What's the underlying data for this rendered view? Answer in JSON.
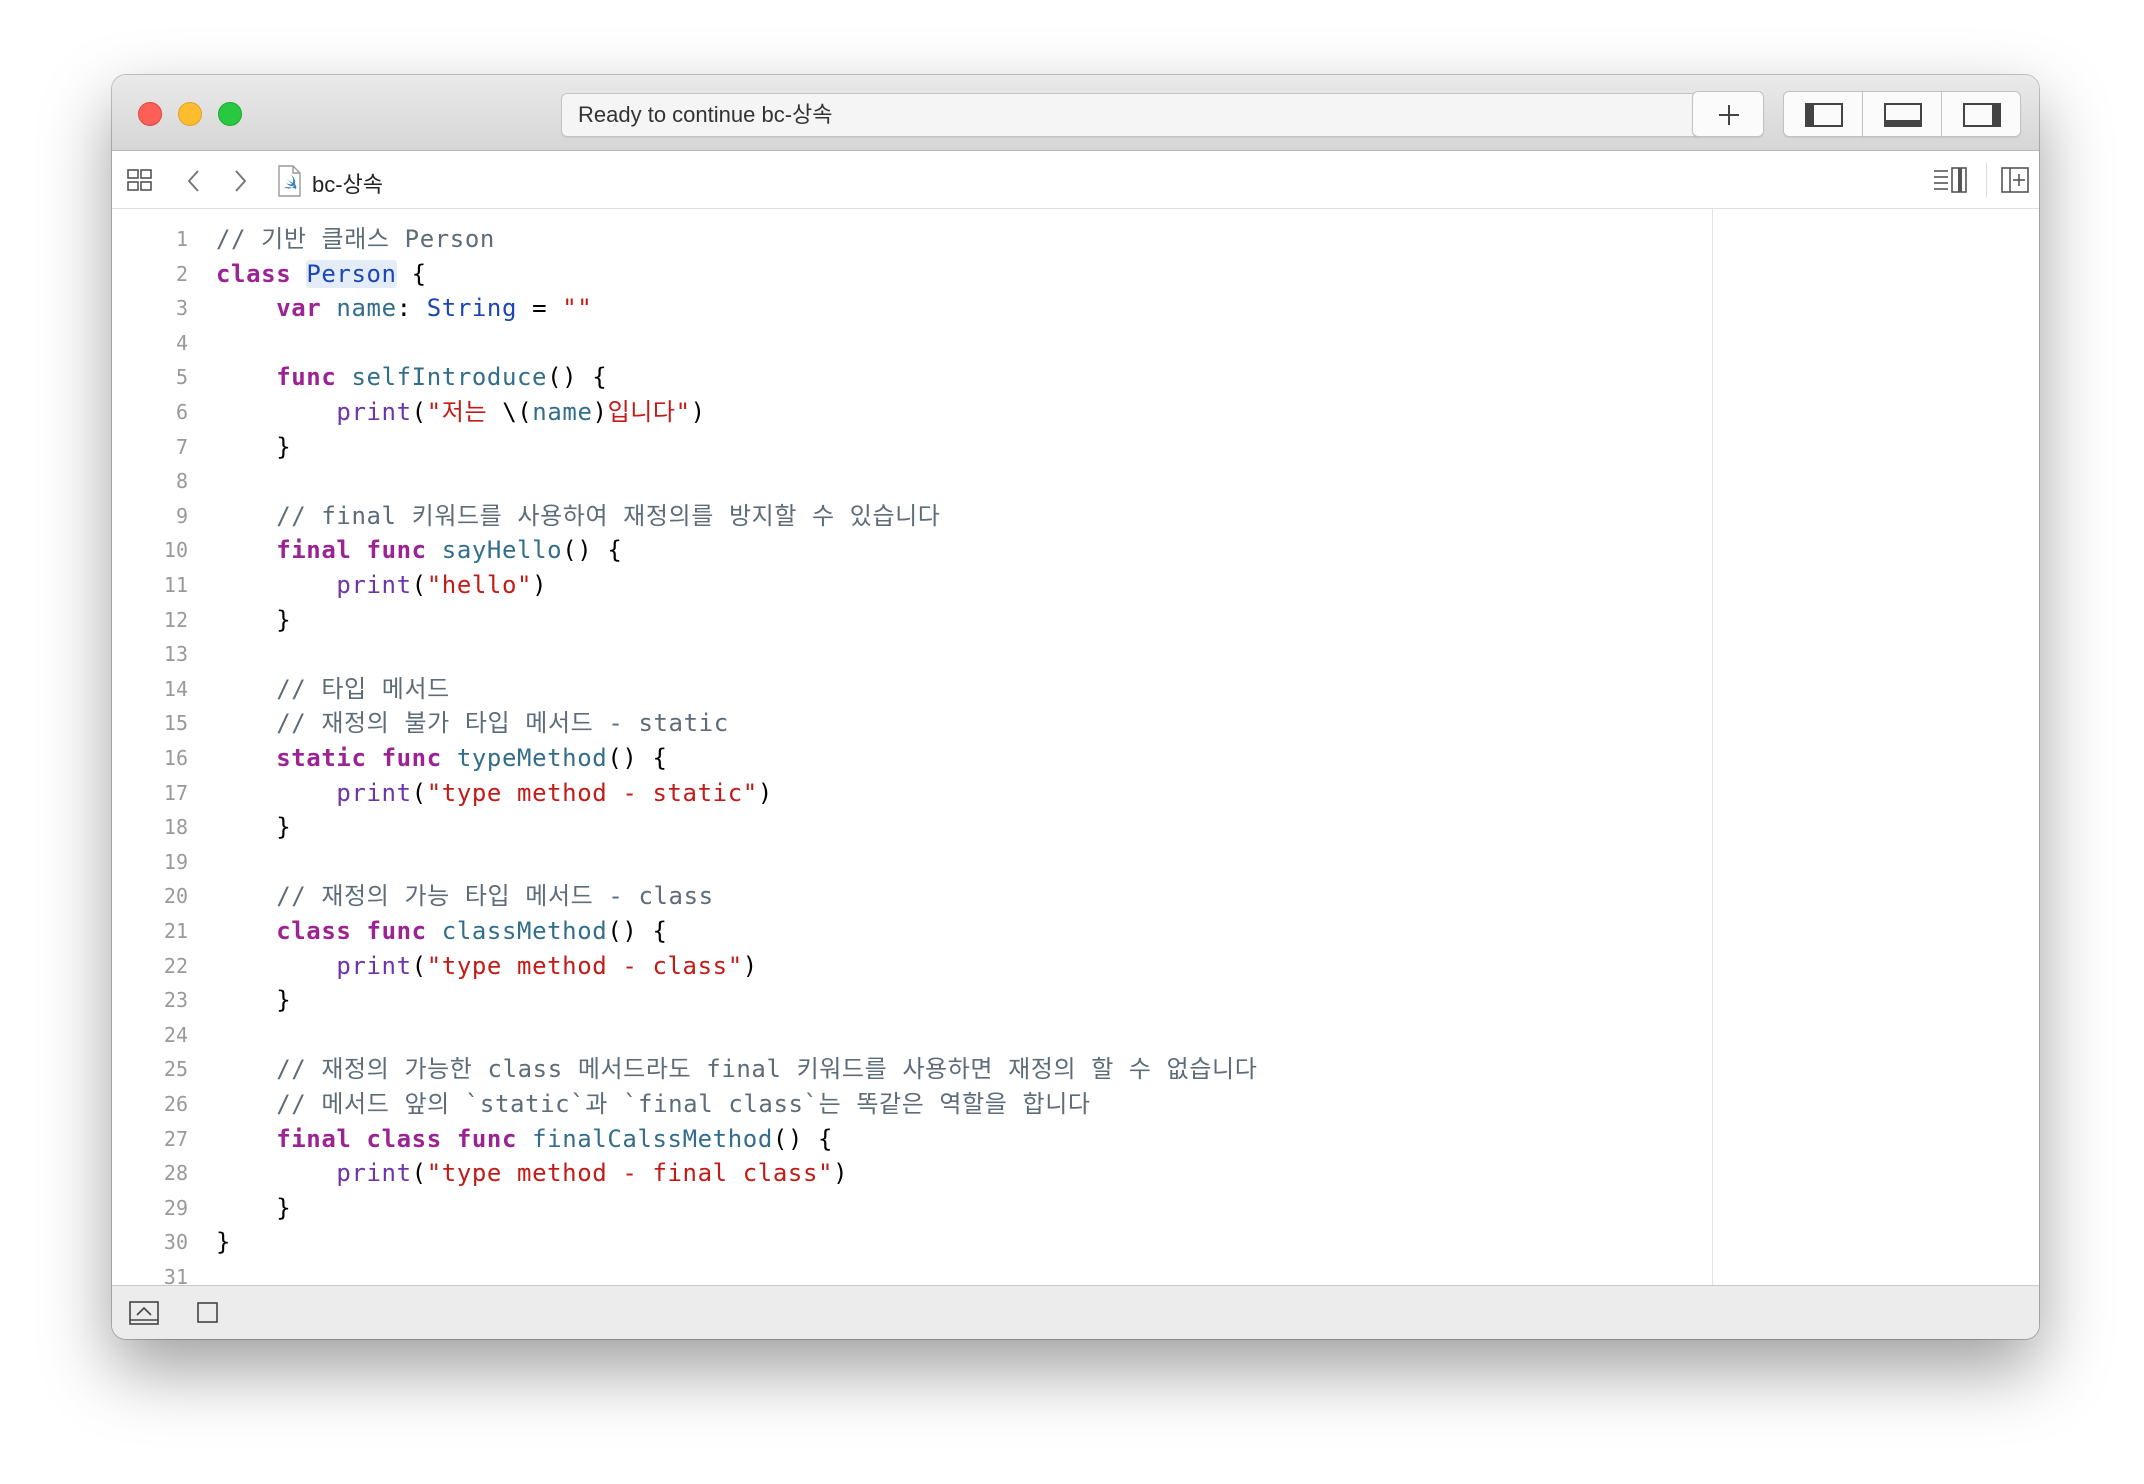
{
  "window": {
    "status_text": "Ready to continue bc-상속"
  },
  "jumpbar": {
    "file_name": "bc-상속"
  },
  "icons": {
    "close": "close-traffic-light",
    "minimize": "minimize-traffic-light",
    "zoom": "zoom-traffic-light",
    "add": "plus-icon",
    "nav_panel": "left-panel-icon",
    "debug_panel": "bottom-panel-icon",
    "inspector_panel": "right-panel-icon",
    "related_items": "grid-icon",
    "back": "chevron-left-icon",
    "forward": "chevron-right-icon",
    "file": "swift-file-icon",
    "editor_options": "editor-options-icon",
    "add_editor": "add-editor-icon",
    "show_debug": "show-debug-area-icon",
    "stop": "stop-icon"
  },
  "colors": {
    "keyword": "#9b2393",
    "type": "#1c46b8",
    "function": "#326d8b",
    "builtin": "#6c36a9",
    "string": "#c41a16",
    "comment": "#5d6c79"
  },
  "code": {
    "line_numbers": [
      "1",
      "2",
      "3",
      "4",
      "5",
      "6",
      "7",
      "8",
      "9",
      "10",
      "11",
      "12",
      "13",
      "14",
      "15",
      "16",
      "17",
      "18",
      "19",
      "20",
      "21",
      "22",
      "23",
      "24",
      "25",
      "26",
      "27",
      "28",
      "29",
      "30",
      "31"
    ],
    "lines": [
      [
        {
          "t": "// 기반 클래스 Person",
          "c": "cm"
        }
      ],
      [
        {
          "t": "class",
          "c": "kw"
        },
        {
          "t": " ",
          "c": ""
        },
        {
          "t": "Person",
          "c": "ty hl"
        },
        {
          "t": " {",
          "c": ""
        }
      ],
      [
        {
          "t": "    ",
          "c": ""
        },
        {
          "t": "var",
          "c": "kw"
        },
        {
          "t": " ",
          "c": ""
        },
        {
          "t": "name",
          "c": "pl"
        },
        {
          "t": ": ",
          "c": ""
        },
        {
          "t": "String",
          "c": "ty"
        },
        {
          "t": " = ",
          "c": ""
        },
        {
          "t": "\"\"",
          "c": "st"
        }
      ],
      [],
      [
        {
          "t": "    ",
          "c": ""
        },
        {
          "t": "func",
          "c": "kw"
        },
        {
          "t": " ",
          "c": ""
        },
        {
          "t": "selfIntroduce",
          "c": "fn"
        },
        {
          "t": "() {",
          "c": ""
        }
      ],
      [
        {
          "t": "        ",
          "c": ""
        },
        {
          "t": "print",
          "c": "bi"
        },
        {
          "t": "(",
          "c": ""
        },
        {
          "t": "\"저는 ",
          "c": "st"
        },
        {
          "t": "\\(",
          "c": ""
        },
        {
          "t": "name",
          "c": "pl"
        },
        {
          "t": ")",
          "c": ""
        },
        {
          "t": "입니다\"",
          "c": "st"
        },
        {
          "t": ")",
          "c": ""
        }
      ],
      [
        {
          "t": "    }",
          "c": ""
        }
      ],
      [],
      [
        {
          "t": "    ",
          "c": ""
        },
        {
          "t": "// final 키워드를 사용하여 재정의를 방지할 수 있습니다",
          "c": "cm"
        }
      ],
      [
        {
          "t": "    ",
          "c": ""
        },
        {
          "t": "final",
          "c": "kw"
        },
        {
          "t": " ",
          "c": ""
        },
        {
          "t": "func",
          "c": "kw"
        },
        {
          "t": " ",
          "c": ""
        },
        {
          "t": "sayHello",
          "c": "fn"
        },
        {
          "t": "() {",
          "c": ""
        }
      ],
      [
        {
          "t": "        ",
          "c": ""
        },
        {
          "t": "print",
          "c": "bi"
        },
        {
          "t": "(",
          "c": ""
        },
        {
          "t": "\"hello\"",
          "c": "st"
        },
        {
          "t": ")",
          "c": ""
        }
      ],
      [
        {
          "t": "    }",
          "c": ""
        }
      ],
      [],
      [
        {
          "t": "    ",
          "c": ""
        },
        {
          "t": "// 타입 메서드",
          "c": "cm"
        }
      ],
      [
        {
          "t": "    ",
          "c": ""
        },
        {
          "t": "// 재정의 불가 타입 메서드 - static",
          "c": "cm"
        }
      ],
      [
        {
          "t": "    ",
          "c": ""
        },
        {
          "t": "static",
          "c": "kw"
        },
        {
          "t": " ",
          "c": ""
        },
        {
          "t": "func",
          "c": "kw"
        },
        {
          "t": " ",
          "c": ""
        },
        {
          "t": "typeMethod",
          "c": "fn"
        },
        {
          "t": "() {",
          "c": ""
        }
      ],
      [
        {
          "t": "        ",
          "c": ""
        },
        {
          "t": "print",
          "c": "bi"
        },
        {
          "t": "(",
          "c": ""
        },
        {
          "t": "\"type method - static\"",
          "c": "st"
        },
        {
          "t": ")",
          "c": ""
        }
      ],
      [
        {
          "t": "    }",
          "c": ""
        }
      ],
      [],
      [
        {
          "t": "    ",
          "c": ""
        },
        {
          "t": "// 재정의 가능 타입 메서드 - class",
          "c": "cm"
        }
      ],
      [
        {
          "t": "    ",
          "c": ""
        },
        {
          "t": "class",
          "c": "kw"
        },
        {
          "t": " ",
          "c": ""
        },
        {
          "t": "func",
          "c": "kw"
        },
        {
          "t": " ",
          "c": ""
        },
        {
          "t": "classMethod",
          "c": "fn"
        },
        {
          "t": "() {",
          "c": ""
        }
      ],
      [
        {
          "t": "        ",
          "c": ""
        },
        {
          "t": "print",
          "c": "bi"
        },
        {
          "t": "(",
          "c": ""
        },
        {
          "t": "\"type method - class\"",
          "c": "st"
        },
        {
          "t": ")",
          "c": ""
        }
      ],
      [
        {
          "t": "    }",
          "c": ""
        }
      ],
      [],
      [
        {
          "t": "    ",
          "c": ""
        },
        {
          "t": "// 재정의 가능한 class 메서드라도 final 키워드를 사용하면 재정의 할 수 없습니다",
          "c": "cm"
        }
      ],
      [
        {
          "t": "    ",
          "c": ""
        },
        {
          "t": "// 메서드 앞의 `static`과 `final class`는 똑같은 역할을 합니다",
          "c": "cm"
        }
      ],
      [
        {
          "t": "    ",
          "c": ""
        },
        {
          "t": "final",
          "c": "kw"
        },
        {
          "t": " ",
          "c": ""
        },
        {
          "t": "class",
          "c": "kw"
        },
        {
          "t": " ",
          "c": ""
        },
        {
          "t": "func",
          "c": "kw"
        },
        {
          "t": " ",
          "c": ""
        },
        {
          "t": "finalCalssMethod",
          "c": "fn"
        },
        {
          "t": "() {",
          "c": ""
        }
      ],
      [
        {
          "t": "        ",
          "c": ""
        },
        {
          "t": "print",
          "c": "bi"
        },
        {
          "t": "(",
          "c": ""
        },
        {
          "t": "\"type method - final class\"",
          "c": "st"
        },
        {
          "t": ")",
          "c": ""
        }
      ],
      [
        {
          "t": "    }",
          "c": ""
        }
      ],
      [
        {
          "t": "}",
          "c": ""
        }
      ],
      []
    ]
  }
}
